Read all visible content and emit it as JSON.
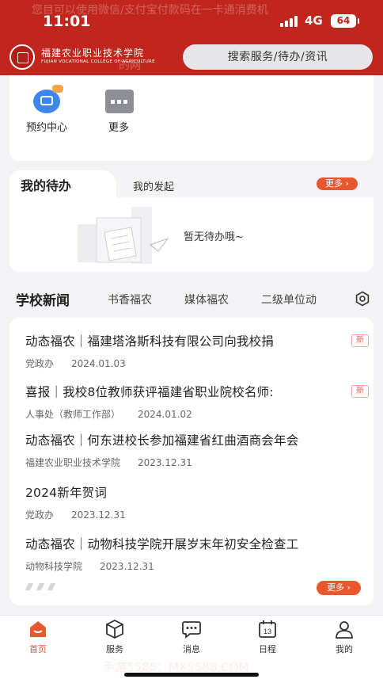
{
  "status_bar": {
    "time": "11:01",
    "network": "4G",
    "battery": "64"
  },
  "header": {
    "ghost_text_top": "您目可以使用微信/支付宝付款码在一卡通消费机",
    "ghost_text_bottom": "的网",
    "logo_cn": "福建农业职业技术学院",
    "logo_en": "FUJIAN VOCATIONAL COLLEGE OF AGRICULTURE",
    "search_placeholder": "搜索服务/待办/资讯"
  },
  "shortcuts": [
    {
      "label": "预约中心",
      "icon": "booking-icon"
    },
    {
      "label": "更多",
      "icon": "more-grid-icon"
    }
  ],
  "todo": {
    "title": "我的待办",
    "tab2": "我的发起",
    "more": "更多",
    "empty_text": "暂无待办哦~"
  },
  "news": {
    "title": "学校新闻",
    "tabs": [
      "书香福农",
      "媒体福农",
      "二级单位动"
    ],
    "items": [
      {
        "title": "动态福农｜福建塔洛斯科技有限公司向我校捐",
        "dept": "党政办",
        "date": "2024.01.03",
        "tag": "新"
      },
      {
        "title": "喜报｜我校8位教师获评福建省职业院校名师:",
        "dept": "人事处（教师工作部）",
        "date": "2024.01.02",
        "tag": "新"
      },
      {
        "title": "动态福农｜何东进校长参加福建省红曲酒商会年会",
        "dept": "福建农业职业技术学院",
        "date": "2023.12.31"
      },
      {
        "title": "2024新年贺词",
        "dept": "党政办",
        "date": "2023.12.31"
      },
      {
        "title": "动态福农｜动物科技学院开展岁末年初安全检查工",
        "dept": "动物科技学院",
        "date": "2023.12.31"
      }
    ],
    "more": "更多"
  },
  "bottom_nav": [
    {
      "label": "首页",
      "icon": "home-icon",
      "active": true
    },
    {
      "label": "服务",
      "icon": "cube-icon"
    },
    {
      "label": "消息",
      "icon": "chat-icon"
    },
    {
      "label": "日程",
      "icon": "calendar-icon",
      "day": "13"
    },
    {
      "label": "我的",
      "icon": "person-icon"
    }
  ],
  "watermark": "手游5588：MX5588.COM",
  "colors": {
    "brand_red": "#c0261d",
    "accent_orange": "#e9572e",
    "booking_blue": "#3e87ea"
  }
}
